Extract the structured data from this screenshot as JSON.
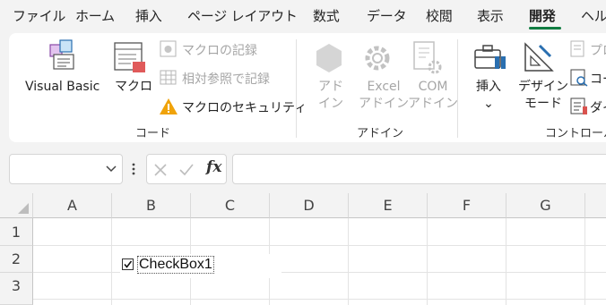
{
  "tabs": [
    {
      "label": "ファイル"
    },
    {
      "label": "ホーム"
    },
    {
      "label": "挿入"
    },
    {
      "label": "ページ レイアウト"
    },
    {
      "label": "数式"
    },
    {
      "label": "データ"
    },
    {
      "label": "校閲"
    },
    {
      "label": "表示"
    },
    {
      "label": "開発",
      "active": true
    },
    {
      "label": "ヘル"
    }
  ],
  "ribbon": {
    "code": {
      "group_label": "コード",
      "visual_basic": "Visual Basic",
      "macro": "マクロ",
      "record_macro": "マクロの記録",
      "relative_ref": "相対参照で記録",
      "macro_security": "マクロのセキュリティ"
    },
    "addins": {
      "group_label": "アドイン",
      "addin_l1": "アド",
      "addin_l2": "イン",
      "excel_l1": "Excel",
      "excel_l2": "アドイン",
      "com_l1": "COM",
      "com_l2": "アドイン"
    },
    "controls": {
      "group_label": "コントロール",
      "insert": "挿入",
      "design_l1": "デザイン",
      "design_l2": "モード",
      "properties": "プロ",
      "view_code": "コー",
      "dialog": "ダイ"
    }
  },
  "formula_bar": {
    "fx": "fx",
    "value": ""
  },
  "grid": {
    "columns": [
      "A",
      "B",
      "C",
      "D",
      "E",
      "F",
      "G"
    ],
    "rows": [
      "1",
      "2",
      "3"
    ]
  },
  "checkbox": {
    "label": "CheckBox1",
    "checked": true
  },
  "colors": {
    "accent": "#107c41",
    "warning": "#f0a30a"
  }
}
